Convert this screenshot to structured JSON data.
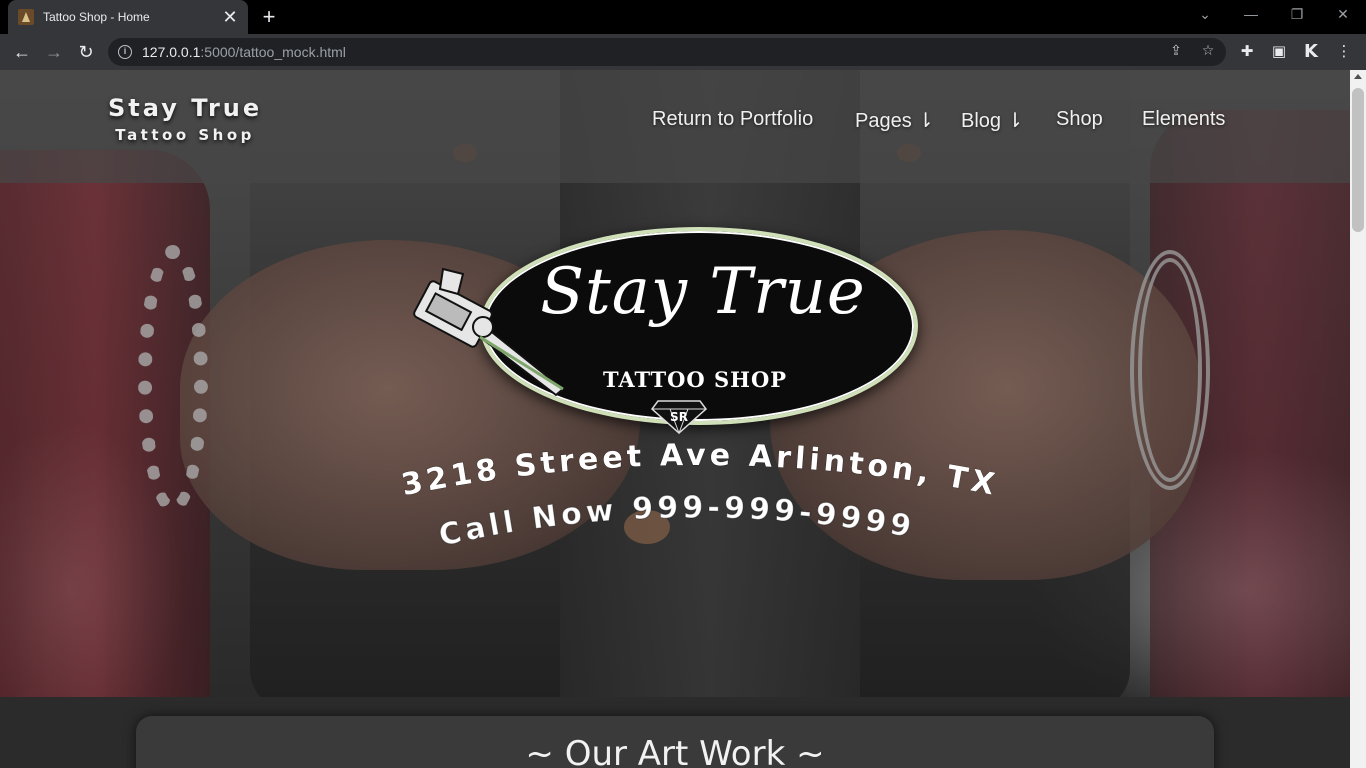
{
  "browser": {
    "tab_title": "Tattoo Shop - Home",
    "url_host": "127.0.0.1",
    "url_path": ":5000/tattoo_mock.html",
    "new_tab": "+",
    "tab_close": "✕",
    "k_label": "K"
  },
  "header": {
    "brand_main": "Stay True",
    "brand_sub": "Tattoo Shop",
    "nav": {
      "portfolio": "Return to Portfolio",
      "pages": "Pages ⇂",
      "blog": "Blog ⇂",
      "shop": "Shop",
      "elements": "Elements"
    }
  },
  "hero": {
    "logo_script": "Stay True",
    "logo_shop": "TATTOO SHOP",
    "logo_monogram": "SR",
    "address": "3218 Street Ave Arlinton, TX",
    "phone": "Call Now 999-999-9999"
  },
  "section": {
    "title": "~ Our Art Work ~"
  }
}
